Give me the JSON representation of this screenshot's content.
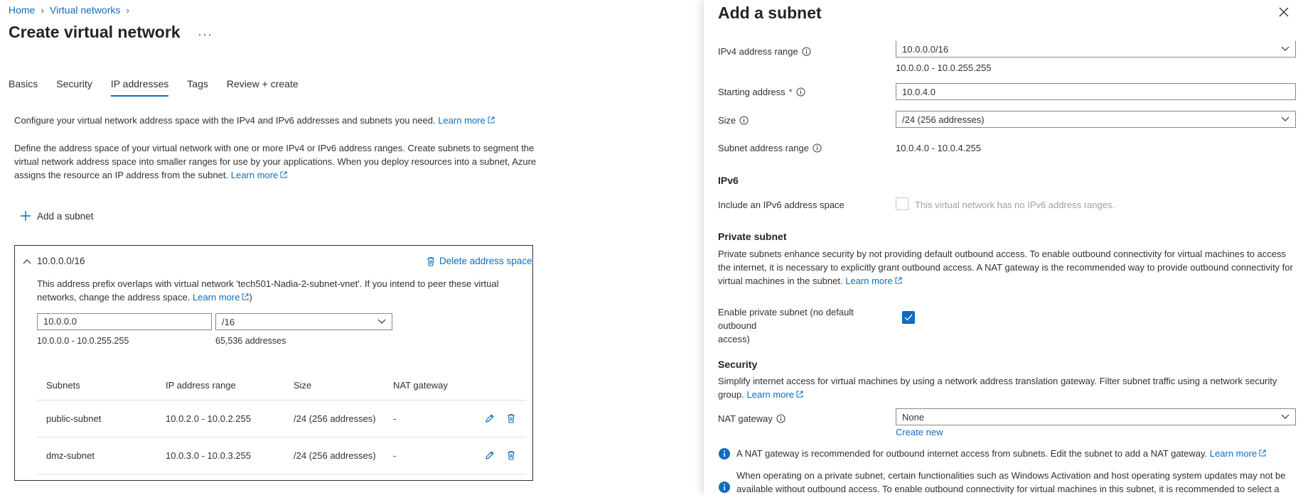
{
  "breadcrumb": {
    "items": [
      "Home",
      "Virtual networks"
    ]
  },
  "page": {
    "title": "Create virtual network",
    "more": "···"
  },
  "tabs": [
    "Basics",
    "Security",
    "IP addresses",
    "Tags",
    "Review + create"
  ],
  "intro": {
    "text": "Configure your virtual network address space with the IPv4 and IPv6 addresses and subnets you need.",
    "link": "Learn more"
  },
  "define": {
    "line1": "Define the address space of your virtual network with one or more IPv4 or IPv6 address ranges. Create subnets to segment the",
    "line2": "virtual network address space into smaller ranges for use by your applications. When you deploy resources into a subnet, Azure",
    "line3": "assigns the resource an IP address from the subnet.",
    "link": "Learn more"
  },
  "add_subnet_label": "Add a subnet",
  "address_space": {
    "cidr": "10.0.0.0/16",
    "delete_label": "Delete address space",
    "warn_line1": "This address prefix overlaps with virtual network 'tech501-Nadia-2-subnet-vnet'. If you intend to peer these virtual",
    "warn_line2": "networks, change the address space.",
    "warn_link": "Learn more",
    "warn_close": ")",
    "address_value": "10.0.0.0",
    "prefix_value": "/16",
    "range_text": "10.0.0.0 - 10.0.255.255",
    "count_text": "65,536 addresses"
  },
  "subnet_table": {
    "headers": [
      "Subnets",
      "IP address range",
      "Size",
      "NAT gateway"
    ],
    "rows": [
      {
        "name": "public-subnet",
        "range": "10.0.2.0 - 10.0.2.255",
        "size": "/24 (256 addresses)",
        "nat": "-"
      },
      {
        "name": "dmz-subnet",
        "range": "10.0.3.0 - 10.0.3.255",
        "size": "/24 (256 addresses)",
        "nat": "-"
      }
    ]
  },
  "panel": {
    "title": "Add a subnet",
    "ipv4_label": "IPv4 address range",
    "ipv4_value": "10.0.0.0/16",
    "ipv4_range": "10.0.0.0 - 10.0.255.255",
    "start_label": "Starting address",
    "start_required": "*",
    "start_value": "10.0.4.0",
    "size_label": "Size",
    "size_value": "/24 (256 addresses)",
    "subnet_range_label": "Subnet address range",
    "subnet_range_value": "10.0.4.0 - 10.0.4.255",
    "ipv6_heading": "IPv6",
    "ipv6_label": "Include an IPv6 address space",
    "ipv6_disabled_text": "This virtual network has no IPv6 address ranges.",
    "private_heading": "Private subnet",
    "private_line1": "Private subnets enhance security by not providing default outbound access. To enable outbound connectivity for virtual machines to access",
    "private_line2": "the internet, it is necessary to explicitly grant outbound access. A NAT gateway is the recommended way to provide outbound connectivity for",
    "private_line3": "virtual machines in the subnet.",
    "private_link": "Learn more",
    "enable_private_line1": "Enable private subnet (no default outbound",
    "enable_private_line2": "access)",
    "enable_private_checked": true,
    "security_heading": "Security",
    "security_line1": "Simplify internet access for virtual machines by using a network address translation gateway. Filter subnet traffic using a network security",
    "security_line2": "group.",
    "security_link": "Learn more",
    "nat_label": "NAT gateway",
    "nat_value": "None",
    "create_new": "Create new",
    "note1_text": "A NAT gateway is recommended for outbound internet access from subnets. Edit the subnet to add a NAT gateway.",
    "note1_link": "Learn more",
    "note2_line1": "When operating on a private subnet, certain functionalities such as Windows Activation and host operating system updates may not be",
    "note2_line2": "available without outbound access. To enable outbound connectivity for virtual machines in this subnet, it is recommended to select a"
  },
  "colors": {
    "accent": "#0f6cbd",
    "text": "#323130",
    "required": "#a4262c"
  }
}
